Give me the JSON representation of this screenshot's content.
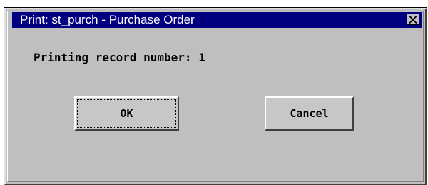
{
  "dialog": {
    "title": "Print: st_purch - Purchase Order",
    "close_icon": "close-icon",
    "message": "Printing record number: 1",
    "buttons": {
      "ok_label": "OK",
      "cancel_label": "Cancel"
    }
  },
  "colors": {
    "titlebar": "#000080",
    "title_text": "#ffffff",
    "dialog_face": "#bfbfbf"
  }
}
